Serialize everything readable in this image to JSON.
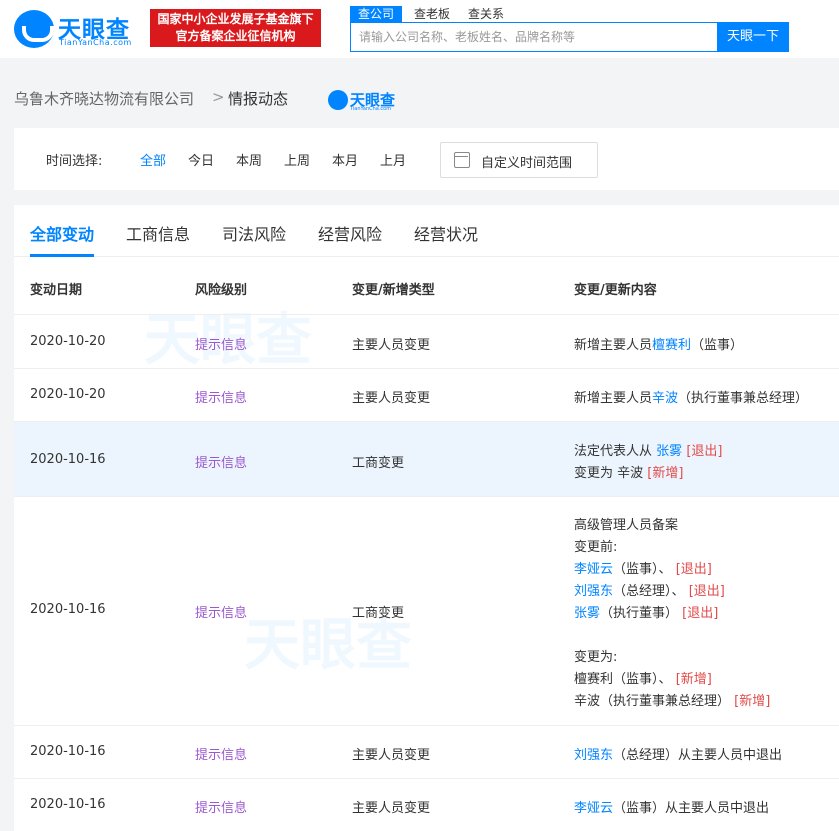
{
  "header": {
    "brand": "天眼查",
    "brand_sub": "TianYanCha.com",
    "badge_line1": "国家中小企业发展子基金旗下",
    "badge_line2": "官方备案企业征信机构",
    "search_tabs": [
      "查公司",
      "查老板",
      "查关系"
    ],
    "search_placeholder": "请输入公司名称、老板姓名、品牌名称等",
    "search_button": "天眼一下"
  },
  "breadcrumb": {
    "company": "乌鲁木齐晓达物流有限公司",
    "separator": ">",
    "current": "情报动态",
    "mini_brand": "天眼查",
    "mini_brand_sub": "TianYanCha.com"
  },
  "filter": {
    "label": "时间选择:",
    "options": [
      "全部",
      "今日",
      "本周",
      "上周",
      "本月",
      "上月"
    ],
    "active": "全部",
    "custom_range": "自定义时间范围"
  },
  "tabs": [
    "全部变动",
    "工商信息",
    "司法风险",
    "经营风险",
    "经营状况"
  ],
  "table": {
    "headers": [
      "变动日期",
      "风险级别",
      "变更/新增类型",
      "变更/更新内容"
    ],
    "rows": [
      {
        "date": "2020-10-20",
        "risk": "提示信息",
        "type": "主要人员变更",
        "content": {
          "prefix": "新增主要人员",
          "name": "檀赛利",
          "suffix": "（监事）"
        }
      },
      {
        "date": "2020-10-20",
        "risk": "提示信息",
        "type": "主要人员变更",
        "content": {
          "prefix": "新增主要人员",
          "name": "辛波",
          "suffix": "（执行董事兼总经理）"
        }
      },
      {
        "date": "2020-10-16",
        "risk": "提示信息",
        "type": "工商变更",
        "content": {
          "line1_prefix": "法定代表人从",
          "line1_name": "张雾",
          "line1_tag": "[退出]",
          "line2_prefix": "变更为 辛波",
          "line2_tag": "[新增]"
        }
      },
      {
        "date": "2020-10-16",
        "risk": "提示信息",
        "type": "工商变更",
        "content": {
          "title": "高级管理人员备案",
          "before_label": "变更前:",
          "before": [
            {
              "name": "李娅云",
              "role": "（监事）",
              "sep": "、",
              "tag": "[退出]"
            },
            {
              "name": "刘强东",
              "role": "（总经理）",
              "sep": "、",
              "tag": "[退出]"
            },
            {
              "name": "张雾",
              "role": "（执行董事）",
              "sep": "",
              "tag": "[退出]"
            }
          ],
          "after_label": "变更为:",
          "after": [
            {
              "name": "檀赛利",
              "role": "（监事）",
              "sep": "、",
              "tag": "[新增]"
            },
            {
              "name": "辛波",
              "role": "（执行董事兼总经理）",
              "sep": "",
              "tag": "[新增]"
            }
          ]
        }
      },
      {
        "date": "2020-10-16",
        "risk": "提示信息",
        "type": "主要人员变更",
        "content": {
          "name": "刘强东",
          "suffix": "（总经理）从主要人员中退出"
        }
      },
      {
        "date": "2020-10-16",
        "risk": "提示信息",
        "type": "主要人员变更",
        "content": {
          "name": "李娅云",
          "suffix": "（监事）从主要人员中退出"
        }
      }
    ]
  },
  "colors": {
    "accent": "#0084ff",
    "risk": "#9b59d0",
    "danger": "#e24a4a",
    "badge": "#d9191c",
    "highlight_row": "#ecf5fd"
  }
}
